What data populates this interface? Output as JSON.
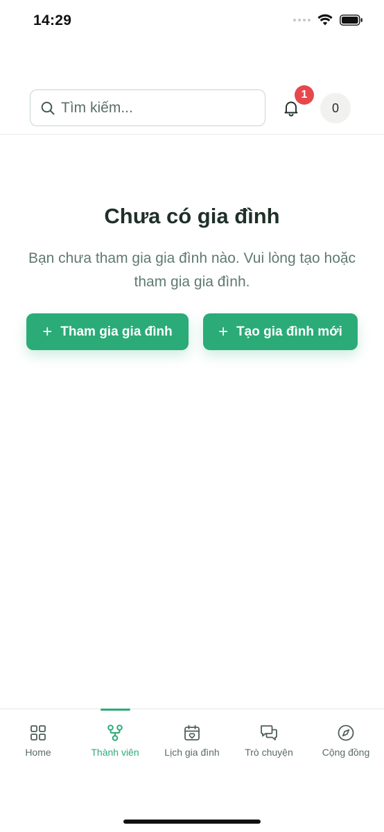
{
  "status_bar": {
    "time": "14:29"
  },
  "header": {
    "search_placeholder": "Tìm kiếm...",
    "notification_count": "1",
    "points": "0"
  },
  "empty_state": {
    "title": "Chưa có gia đình",
    "description": "Bạn chưa tham gia gia đình nào. Vui lòng tạo hoặc tham gia gia đình.",
    "join_button": "Tham gia gia đình",
    "create_button": "Tạo gia đình mới"
  },
  "bottom_nav": {
    "items": [
      {
        "label": "Home",
        "icon": "grid-icon"
      },
      {
        "label": "Thành viên",
        "icon": "family-tree-icon",
        "active": true
      },
      {
        "label": "Lịch gia đình",
        "icon": "calendar-heart-icon"
      },
      {
        "label": "Trò chuyện",
        "icon": "chat-icon"
      },
      {
        "label": "Cộng đồng",
        "icon": "compass-icon"
      }
    ]
  },
  "colors": {
    "accent": "#2aab77",
    "badge": "#e5484d",
    "title": "#1f3029"
  }
}
